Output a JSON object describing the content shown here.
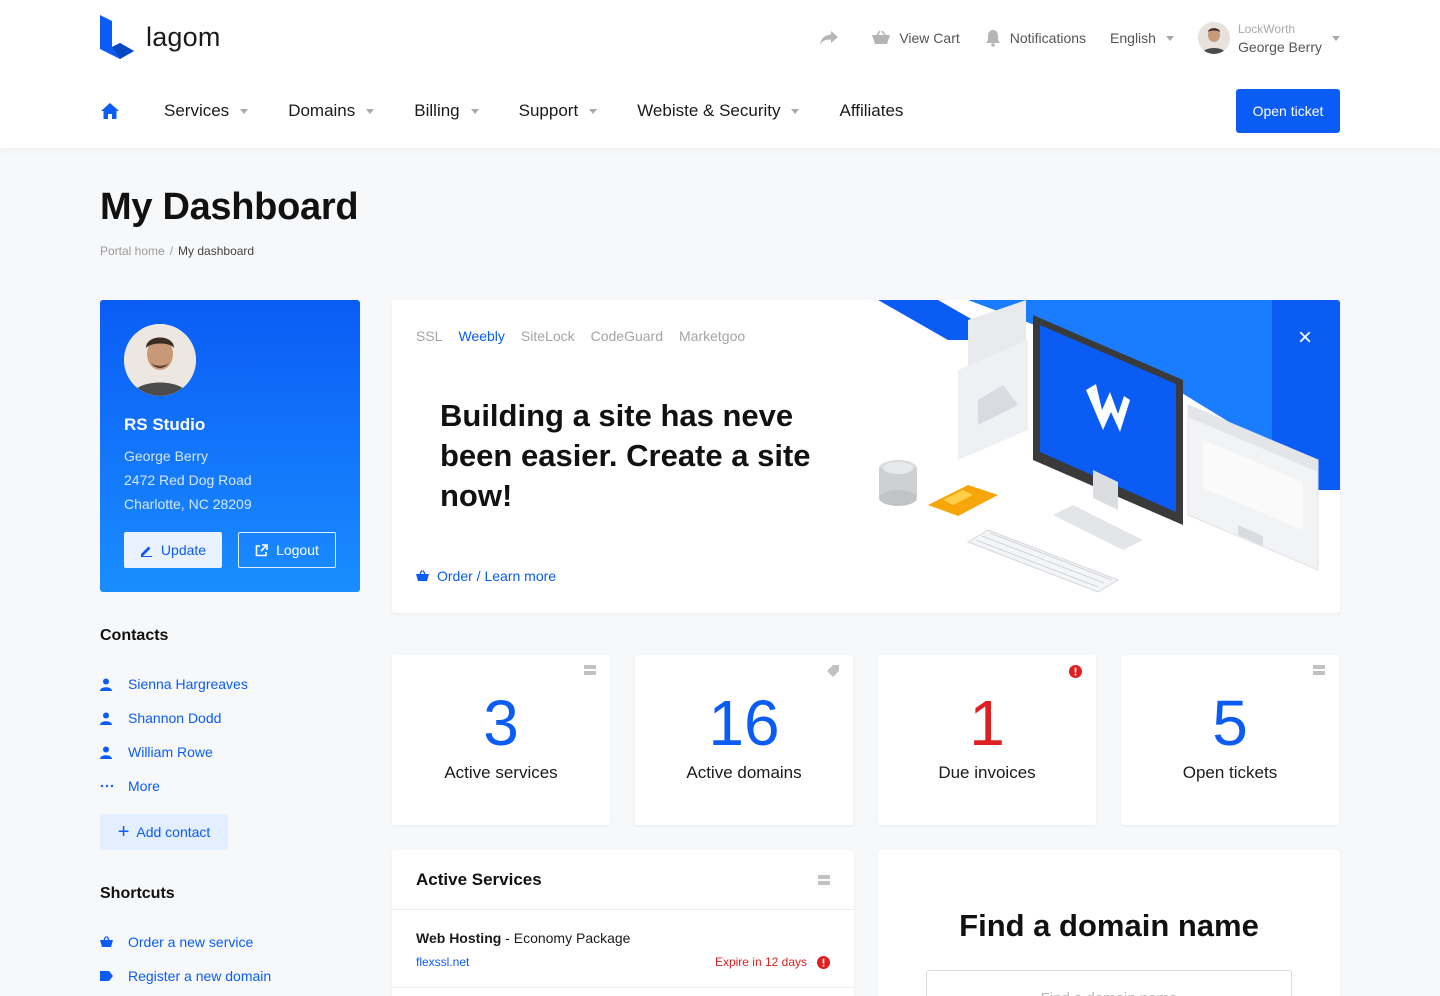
{
  "brand": {
    "name": "lagom",
    "accent": "#0a5cf5"
  },
  "topbar": {
    "view_cart": "View Cart",
    "notifications": "Notifications",
    "language": "English",
    "user_company": "LockWorth",
    "user_name": "George Berry"
  },
  "nav": {
    "items": [
      {
        "label": "Services",
        "has_dropdown": true
      },
      {
        "label": "Domains",
        "has_dropdown": true
      },
      {
        "label": "Billing",
        "has_dropdown": true
      },
      {
        "label": "Support",
        "has_dropdown": true
      },
      {
        "label": "Webiste & Security",
        "has_dropdown": true
      },
      {
        "label": "Affiliates",
        "has_dropdown": false
      }
    ],
    "cta": "Open ticket"
  },
  "page": {
    "title": "My Dashboard",
    "breadcrumb": [
      "Portal home",
      "My dashboard"
    ]
  },
  "profile": {
    "company": "RS Studio",
    "name": "George Berry",
    "address_line1": "2472 Red Dog Road",
    "address_line2": "Charlotte, NC 28209",
    "update_label": "Update",
    "logout_label": "Logout"
  },
  "contacts": {
    "title": "Contacts",
    "items": [
      "Sienna Hargreaves",
      "Shannon Dodd",
      "William Rowe"
    ],
    "more_label": "More",
    "add_label": "Add contact"
  },
  "shortcuts": {
    "title": "Shortcuts",
    "items": [
      "Order a new service",
      "Register a new domain"
    ]
  },
  "promo": {
    "tabs": [
      "SSL",
      "Weebly",
      "SiteLock",
      "CodeGuard",
      "Marketgoo"
    ],
    "active_tab": "Weebly",
    "headline": "Building a site has neve been easier. Create a site now!",
    "link": "Order / Learn more",
    "close_symbol": "×"
  },
  "stats": [
    {
      "value": "3",
      "label": "Active services",
      "icon": "server-icon",
      "color": "#0a5cf5"
    },
    {
      "value": "16",
      "label": "Active domains",
      "icon": "tag-icon",
      "color": "#0a5cf5"
    },
    {
      "value": "1",
      "label": "Due invoices",
      "icon": "alert-icon",
      "color": "#e02020"
    },
    {
      "value": "5",
      "label": "Open tickets",
      "icon": "server-icon",
      "color": "#0a5cf5"
    }
  ],
  "active_services": {
    "title": "Active Services",
    "rows": [
      {
        "product": "Web Hosting",
        "package": " - Economy Package",
        "domain": "flexssl.net",
        "status": "Expire in 12 days"
      }
    ]
  },
  "domain_search": {
    "title": "Find a domain name",
    "placeholder": "Find a domain name"
  }
}
